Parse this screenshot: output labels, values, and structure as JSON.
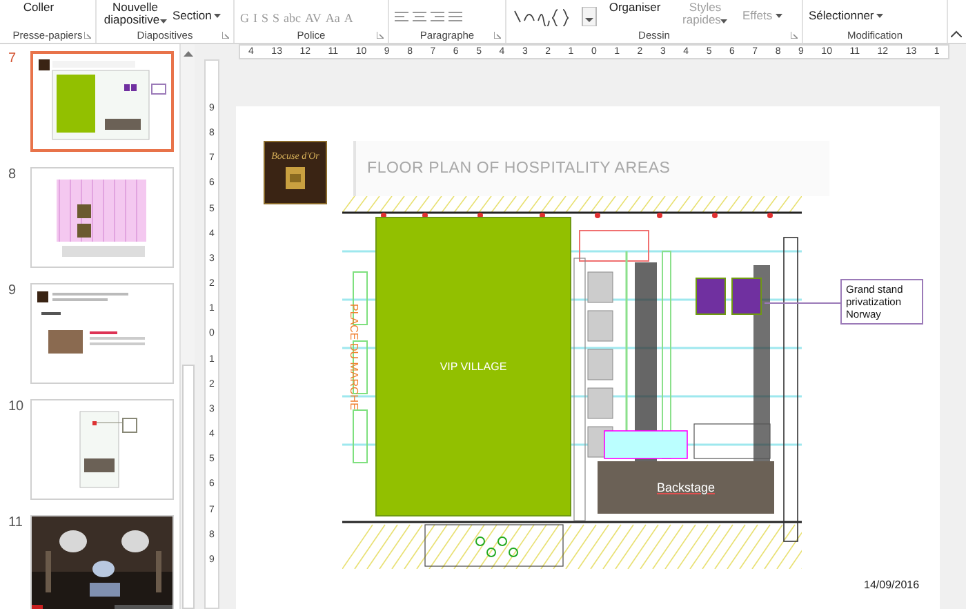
{
  "ribbon": {
    "groups": [
      {
        "kind": "clipboard",
        "label": "Presse-papiers",
        "items": [
          {
            "kind": "large",
            "label": "Coller",
            "dropdown": false,
            "disabled": false
          }
        ]
      },
      {
        "kind": "slides",
        "label": "Diapositives",
        "items": [
          {
            "kind": "large",
            "label": "Nouvelle diapositive",
            "dropdown": true,
            "disabled": false
          },
          {
            "kind": "small",
            "label": "Section",
            "dropdown": true,
            "disabled": false
          }
        ]
      },
      {
        "kind": "font",
        "label": "Police",
        "items": [
          {
            "kind": "glyph",
            "label": "G",
            "disabled": true
          },
          {
            "kind": "glyph",
            "label": "I",
            "disabled": true
          },
          {
            "kind": "glyph",
            "label": "S",
            "disabled": true
          },
          {
            "kind": "glyph",
            "label": "S",
            "disabled": true
          },
          {
            "kind": "glyph",
            "label": "abc",
            "disabled": true
          },
          {
            "kind": "glyph",
            "label": "AV",
            "disabled": true
          },
          {
            "kind": "glyph",
            "label": "Aa",
            "disabled": true
          },
          {
            "kind": "glyph",
            "label": "A",
            "disabled": true
          }
        ]
      },
      {
        "kind": "paragraph",
        "label": "Paragraphe"
      },
      {
        "kind": "drawing",
        "label": "Dessin",
        "items": [
          {
            "kind": "large",
            "label": "Organiser",
            "dropdown": false,
            "disabled": false
          },
          {
            "kind": "large",
            "label": "Styles rapides",
            "dropdown": true,
            "disabled": true
          },
          {
            "kind": "small",
            "label": "Effets",
            "dropdown": true,
            "disabled": true
          }
        ]
      },
      {
        "kind": "editing",
        "label": "Modification",
        "items": [
          {
            "kind": "small",
            "label": "Sélectionner",
            "dropdown": true,
            "disabled": false
          }
        ]
      }
    ]
  },
  "ruler": {
    "horizontal": [
      "4",
      "13",
      "12",
      "11",
      "10",
      "9",
      "8",
      "7",
      "6",
      "5",
      "4",
      "3",
      "2",
      "1",
      "0",
      "1",
      "2",
      "3",
      "4",
      "5",
      "6",
      "7",
      "8",
      "9",
      "10",
      "11",
      "12",
      "13",
      "1"
    ],
    "vertical": [
      "9",
      "8",
      "7",
      "6",
      "5",
      "4",
      "3",
      "2",
      "1",
      "0",
      "1",
      "2",
      "3",
      "4",
      "5",
      "6",
      "7",
      "8",
      "9"
    ]
  },
  "thumbnails": [
    {
      "number": "7",
      "kind": "floorplan",
      "selected": true
    },
    {
      "number": "8",
      "kind": "pinkplan",
      "selected": false
    },
    {
      "number": "9",
      "kind": "text",
      "selected": false
    },
    {
      "number": "10",
      "kind": "plan",
      "selected": false
    },
    {
      "number": "11",
      "kind": "picture",
      "selected": false
    }
  ],
  "slide": {
    "logo_text": "Bocuse d'Or",
    "title": "FLOOR PLAN OF HOSPITALITY AREAS",
    "street_label": "PLACE DU MARCHE",
    "areas": [
      {
        "kind": "village",
        "label": "VIP VILLAGE"
      },
      {
        "kind": "backstage",
        "label": "Backstage"
      }
    ],
    "callout": "Grand stand privatization Norway",
    "date": "14/09/2016"
  }
}
